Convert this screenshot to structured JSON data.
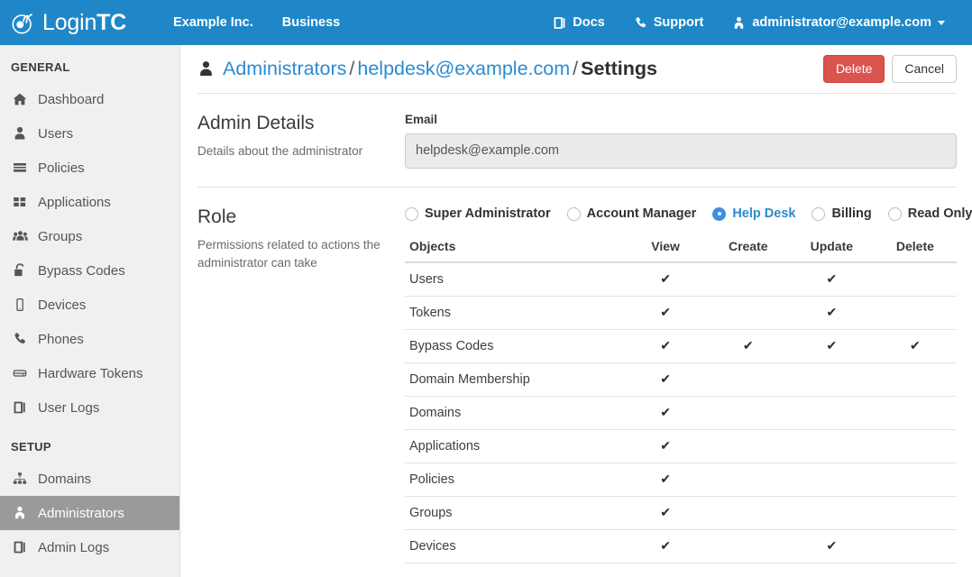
{
  "topnav": {
    "brand": {
      "light": "Login",
      "bold": "TC",
      "icon": "logintc-logo-icon"
    },
    "left_items": [
      {
        "label": "Example Inc."
      },
      {
        "label": "Business"
      }
    ],
    "right_items": [
      {
        "label": "Docs",
        "icon": "book-icon"
      },
      {
        "label": "Support",
        "icon": "phone-icon"
      },
      {
        "label": "administrator@example.com",
        "icon": "user-tie-icon",
        "caret": true
      }
    ],
    "background": "#1f87c7"
  },
  "sidebar": {
    "sections": [
      {
        "title": "GENERAL",
        "items": [
          {
            "label": "Dashboard",
            "icon": "home-icon",
            "active": false
          },
          {
            "label": "Users",
            "icon": "user-icon",
            "active": false
          },
          {
            "label": "Policies",
            "icon": "sliders-icon",
            "active": false
          },
          {
            "label": "Applications",
            "icon": "grid-icon",
            "active": false
          },
          {
            "label": "Groups",
            "icon": "users-group-icon",
            "active": false
          },
          {
            "label": "Bypass Codes",
            "icon": "unlock-icon",
            "active": false
          },
          {
            "label": "Devices",
            "icon": "mobile-icon",
            "active": false
          },
          {
            "label": "Phones",
            "icon": "phone-icon",
            "active": false
          },
          {
            "label": "Hardware Tokens",
            "icon": "hdd-icon",
            "active": false
          },
          {
            "label": "User Logs",
            "icon": "book-icon",
            "active": false
          }
        ]
      },
      {
        "title": "SETUP",
        "items": [
          {
            "label": "Domains",
            "icon": "sitemap-icon",
            "active": false
          },
          {
            "label": "Administrators",
            "icon": "user-tie-icon",
            "active": true
          },
          {
            "label": "Admin Logs",
            "icon": "book-icon",
            "active": false
          }
        ]
      }
    ],
    "active_background": "#9a9a9a"
  },
  "page": {
    "breadcrumb": {
      "icon": "user-icon",
      "root": "Administrators",
      "parent": "helpdesk@example.com",
      "current": "Settings",
      "separator": "/"
    },
    "buttons": {
      "delete": {
        "label": "Delete",
        "color": "#d9534f"
      },
      "cancel": {
        "label": "Cancel"
      }
    }
  },
  "admin_details": {
    "title": "Admin Details",
    "description": "Details about the administrator",
    "email_label": "Email",
    "email_value": "helpdesk@example.com",
    "email_disabled": true
  },
  "role": {
    "title": "Role",
    "description": "Permissions related to actions the administrator can take",
    "options": [
      {
        "label": "Super Administrator",
        "selected": false
      },
      {
        "label": "Account Manager",
        "selected": false
      },
      {
        "label": "Help Desk",
        "selected": true
      },
      {
        "label": "Billing",
        "selected": false
      },
      {
        "label": "Read Only",
        "selected": false
      }
    ],
    "selected_color": "#3b8ee0",
    "table": {
      "headers": [
        "Objects",
        "View",
        "Create",
        "Update",
        "Delete"
      ],
      "check_glyph": "✔",
      "rows": [
        {
          "object": "Users",
          "view": true,
          "create": false,
          "update": true,
          "delete": false
        },
        {
          "object": "Tokens",
          "view": true,
          "create": false,
          "update": true,
          "delete": false
        },
        {
          "object": "Bypass Codes",
          "view": true,
          "create": true,
          "update": true,
          "delete": true
        },
        {
          "object": "Domain Membership",
          "view": true,
          "create": false,
          "update": false,
          "delete": false
        },
        {
          "object": "Domains",
          "view": true,
          "create": false,
          "update": false,
          "delete": false
        },
        {
          "object": "Applications",
          "view": true,
          "create": false,
          "update": false,
          "delete": false
        },
        {
          "object": "Policies",
          "view": true,
          "create": false,
          "update": false,
          "delete": false
        },
        {
          "object": "Groups",
          "view": true,
          "create": false,
          "update": false,
          "delete": false
        },
        {
          "object": "Devices",
          "view": true,
          "create": false,
          "update": true,
          "delete": false
        }
      ]
    }
  }
}
